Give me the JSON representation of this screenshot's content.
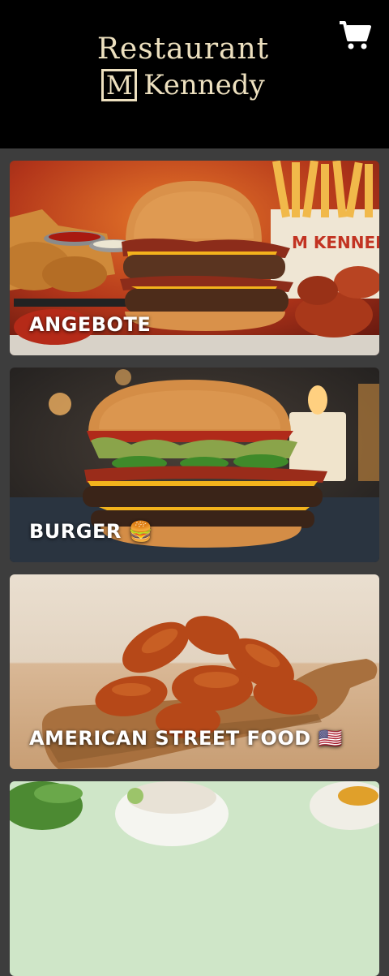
{
  "header": {
    "logo_line1": "Restaurant",
    "logo_mark": "M",
    "logo_line2": "Kennedy",
    "cart_icon": "shopping-cart-icon"
  },
  "categories": [
    {
      "label": "ANGEBOTE"
    },
    {
      "label": "BURGER 🍔"
    },
    {
      "label": "AMERICAN STREET FOOD 🇺🇸"
    },
    {
      "label": ""
    }
  ],
  "food_images": {
    "fries_box_text": "M KENNEDY"
  },
  "colors": {
    "header_bg": "#000000",
    "logo_gold": "#ede0bf",
    "page_bg": "#3d3d3d",
    "label_text": "#ffffff"
  }
}
